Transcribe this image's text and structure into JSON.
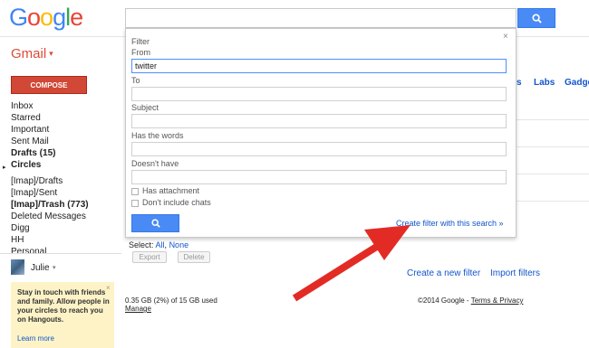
{
  "header": {
    "logo_letters": [
      {
        "ch": "G",
        "color": "#4285f4"
      },
      {
        "ch": "o",
        "color": "#ea4335"
      },
      {
        "ch": "o",
        "color": "#fbbc05"
      },
      {
        "ch": "g",
        "color": "#4285f4"
      },
      {
        "ch": "l",
        "color": "#34a853"
      },
      {
        "ch": "e",
        "color": "#ea4335"
      }
    ],
    "app_label": "Gmail",
    "app_caret": "▾"
  },
  "sidebar": {
    "compose_label": "COMPOSE",
    "items": [
      {
        "label": "Inbox",
        "bold": false
      },
      {
        "label": "Starred",
        "bold": false
      },
      {
        "label": "Important",
        "bold": false
      },
      {
        "label": "Sent Mail",
        "bold": false
      },
      {
        "label": "Drafts (15)",
        "bold": true
      },
      {
        "label": "Circles",
        "bold": true
      },
      {
        "label": "[Imap]/Drafts",
        "bold": false
      },
      {
        "label": "[Imap]/Sent",
        "bold": false
      },
      {
        "label": "[Imap]/Trash (773)",
        "bold": true
      },
      {
        "label": "Deleted Messages",
        "bold": false
      },
      {
        "label": "Digg",
        "bold": false
      },
      {
        "label": "HH",
        "bold": false
      },
      {
        "label": "Personal",
        "bold": false
      }
    ],
    "circles_arrow": "▸",
    "user_name": "Julie",
    "user_caret": "▾"
  },
  "hangouts": {
    "text": "Stay in touch with friends and family. Allow people in your circles to reach you on Hangouts.",
    "more": "Learn more",
    "close": "×"
  },
  "settings_tabs": {
    "partial": "s",
    "labs": "Labs",
    "gadgets": "Gadge"
  },
  "filters_area": {
    "select_label": "Select:",
    "select_all": "All",
    "select_none": "None",
    "export_label": "Export",
    "delete_label": "Delete",
    "create_new_filter": "Create a new filter",
    "import_filters": "Import filters"
  },
  "footer": {
    "storage": "0.35 GB (2%) of 15 GB used",
    "manage": "Manage",
    "copyright": "©2014 Google - ",
    "terms": "Terms & Privacy"
  },
  "filter_panel": {
    "title": "Filter",
    "close": "×",
    "from_label": "From",
    "from_value": "twitter",
    "to_label": "To",
    "to_value": "",
    "subject_label": "Subject",
    "subject_value": "",
    "has_words_label": "Has the words",
    "has_words_value": "",
    "doesnt_have_label": "Doesn't have",
    "doesnt_have_value": "",
    "has_attachment_label": "Has attachment",
    "has_attachment_checked": false,
    "dont_include_chats_label": "Don't include chats",
    "dont_include_chats_checked": false,
    "create_filter_link": "Create filter with this search »"
  },
  "colors": {
    "search_blue": "#4a8af4",
    "compose_red": "#d14836",
    "link_blue": "#15c",
    "annotation_arrow": "#e32b25",
    "hangouts_bg": "#fdf3c7"
  }
}
